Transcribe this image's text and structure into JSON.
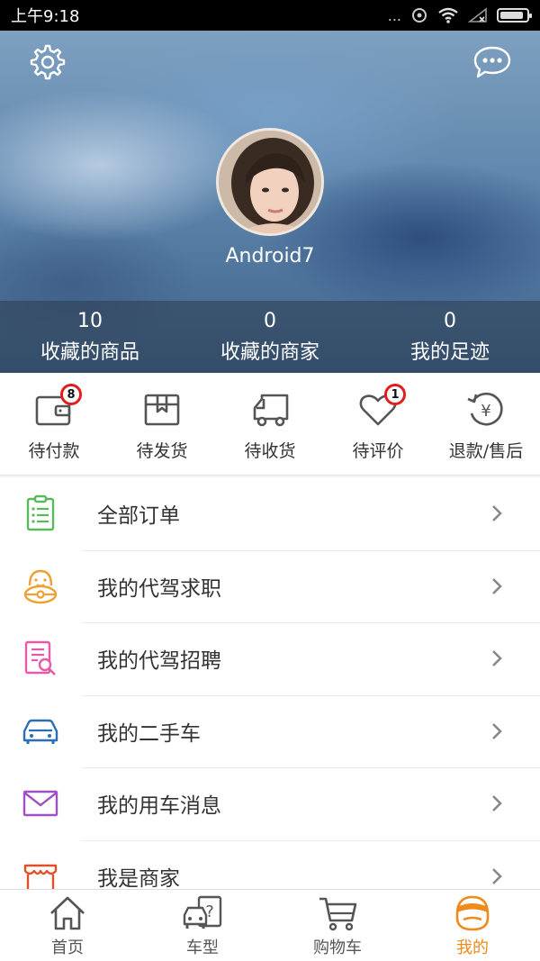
{
  "status_bar": {
    "time": "上午9:18",
    "dots": "...",
    "battery_level": 0.9
  },
  "header": {
    "settings_icon": "gear-icon",
    "message_icon": "chat-bubble-icon",
    "username": "Android7",
    "stats": [
      {
        "value": "10",
        "label": "收藏的商品"
      },
      {
        "value": "0",
        "label": "收藏的商家"
      },
      {
        "value": "0",
        "label": "我的足迹"
      }
    ]
  },
  "orders": [
    {
      "label": "待付款",
      "icon": "wallet-icon",
      "badge": "8"
    },
    {
      "label": "待发货",
      "icon": "box-icon",
      "badge": ""
    },
    {
      "label": "待收货",
      "icon": "truck-icon",
      "badge": ""
    },
    {
      "label": "待评价",
      "icon": "heart-icon",
      "badge": "1"
    },
    {
      "label": "退款/售后",
      "icon": "refund-icon",
      "badge": ""
    }
  ],
  "menu": [
    {
      "label": "全部订单",
      "icon": "clipboard-icon",
      "color": "#5cb85c"
    },
    {
      "label": "我的代驾求职",
      "icon": "driver-icon",
      "color": "#f0a030"
    },
    {
      "label": "我的代驾招聘",
      "icon": "document-search-icon",
      "color": "#e85aa8"
    },
    {
      "label": "我的二手车",
      "icon": "car-icon",
      "color": "#2a6fb5"
    },
    {
      "label": "我的用车消息",
      "icon": "envelope-icon",
      "color": "#a34fc4"
    },
    {
      "label": "我是商家",
      "icon": "shop-icon",
      "color": "#e0502a"
    }
  ],
  "tabbar": [
    {
      "label": "首页",
      "icon": "home-icon",
      "active": false
    },
    {
      "label": "车型",
      "icon": "car-model-icon",
      "active": false
    },
    {
      "label": "购物车",
      "icon": "cart-icon",
      "active": false
    },
    {
      "label": "我的",
      "icon": "profile-icon",
      "active": true
    }
  ],
  "colors": {
    "accent": "#f08a1a",
    "badge": "#e01e1e"
  }
}
